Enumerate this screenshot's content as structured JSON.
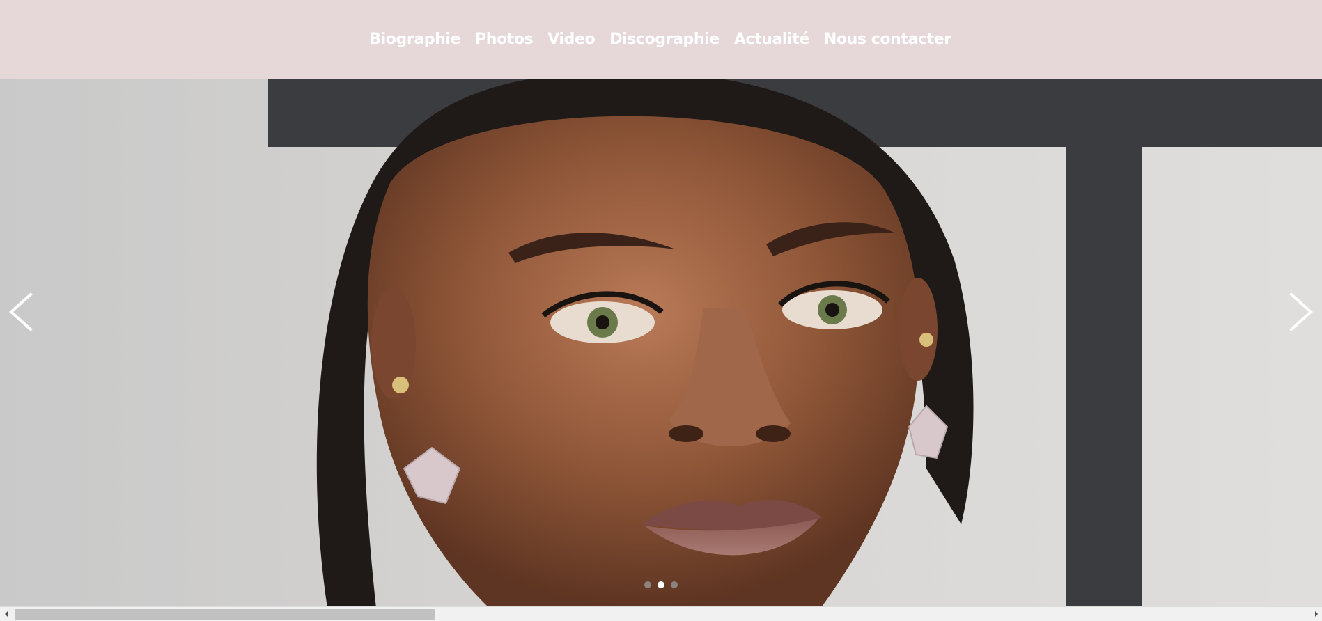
{
  "nav": {
    "items": [
      {
        "label": "Biographie"
      },
      {
        "label": "Photos"
      },
      {
        "label": "Video"
      },
      {
        "label": "Discographie"
      },
      {
        "label": "Actualité"
      },
      {
        "label": "Nous contacter"
      }
    ]
  },
  "carousel": {
    "slide_count": 3,
    "active_slide": 2,
    "prev_icon": "chevron-left-icon",
    "next_icon": "chevron-right-icon"
  },
  "scrollbar": {
    "orientation": "horizontal",
    "left_icon": "triangle-left-icon",
    "right_icon": "triangle-right-icon"
  },
  "colors": {
    "header_bg": "#e6d8d8",
    "nav_text": "#ffffff",
    "photo_bg": "#cfcfcf"
  }
}
